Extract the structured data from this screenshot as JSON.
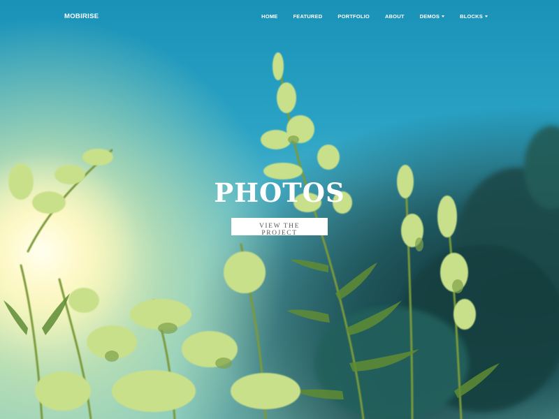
{
  "navbar": {
    "brand": "MOBIRISE",
    "items": [
      {
        "label": "HOME",
        "dropdown": false
      },
      {
        "label": "FEATURED",
        "dropdown": false
      },
      {
        "label": "PORTFOLIO",
        "dropdown": false
      },
      {
        "label": "ABOUT",
        "dropdown": false
      },
      {
        "label": "DEMOS",
        "dropdown": true
      },
      {
        "label": "BLOCKS",
        "dropdown": true
      }
    ]
  },
  "hero": {
    "title": "PHOTOS",
    "button_label": "VIEW THE PROJECT"
  },
  "colors": {
    "sky": "#2aa2c4",
    "plant": "#b8d67a",
    "button_bg": "#ffffff",
    "button_text": "#555555"
  }
}
